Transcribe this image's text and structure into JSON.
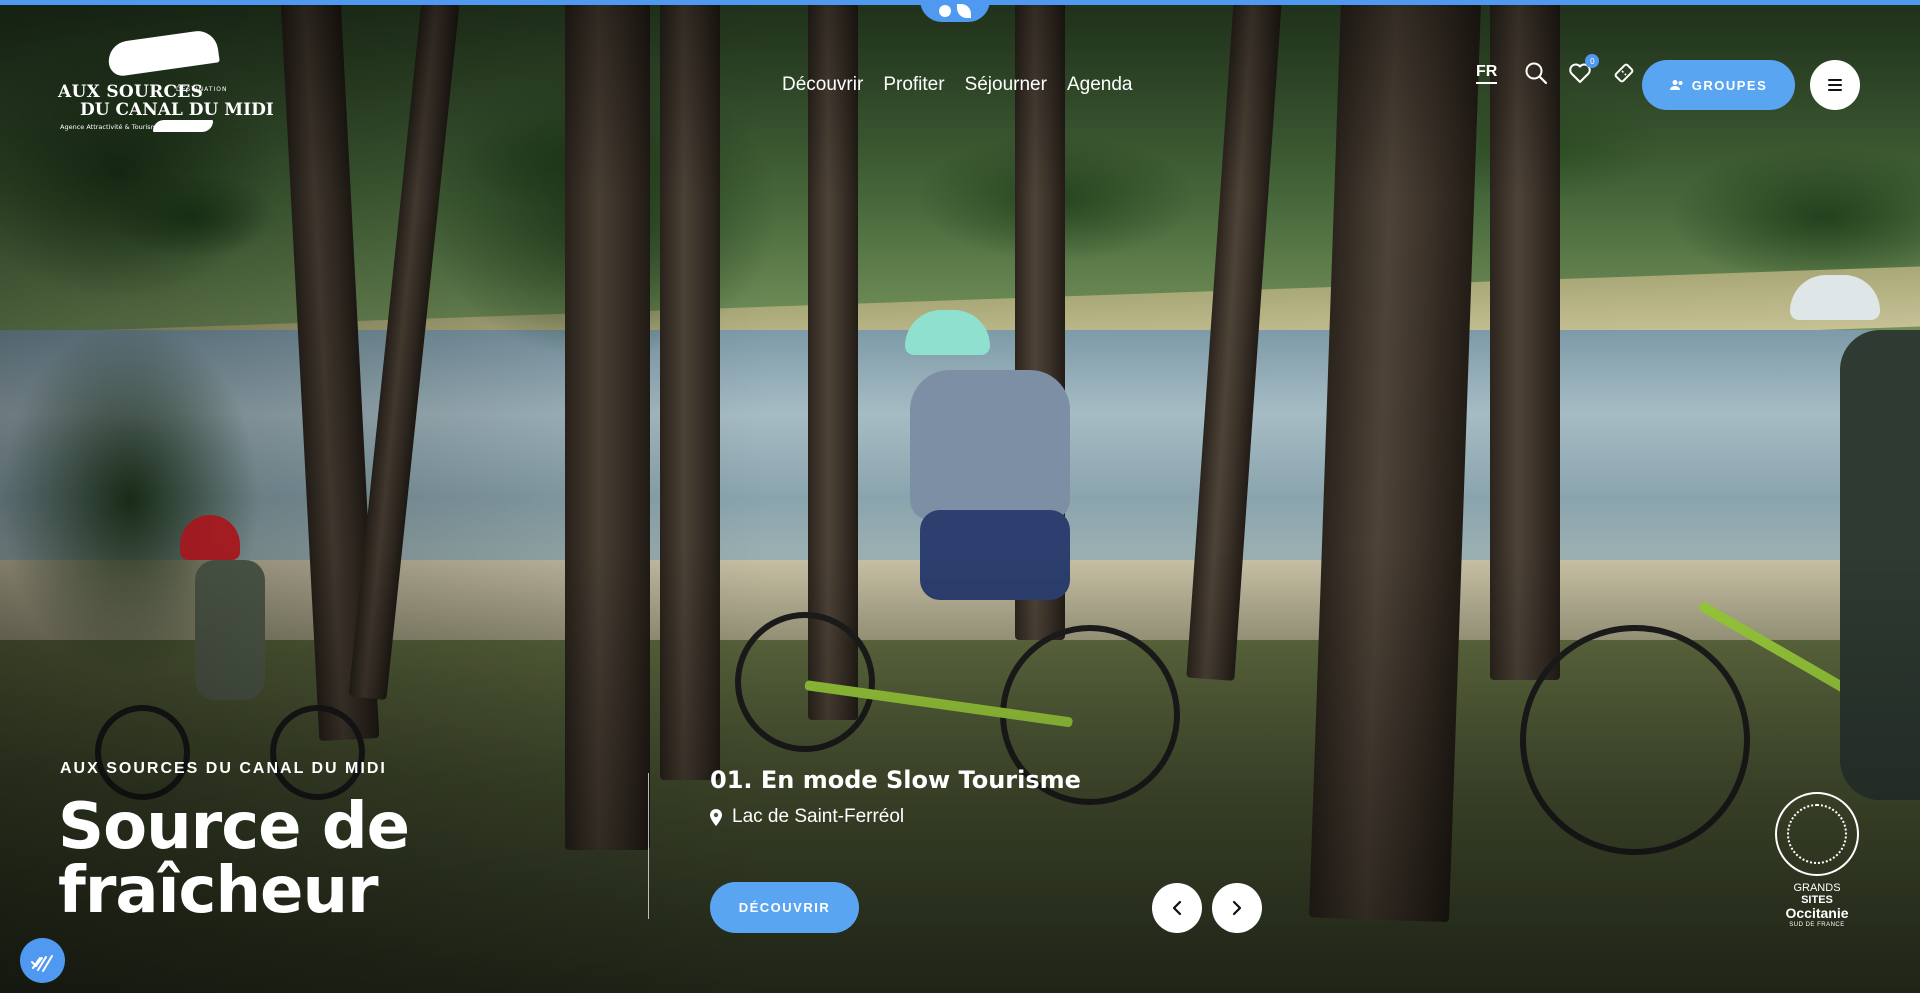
{
  "top_bar": {
    "accent": "#4f9af0"
  },
  "logo": {
    "line1": "AUX SOURCES",
    "destination": "DESTINATION",
    "line2": "DU CANAL DU MIDI",
    "tagline": "Agence Attractivité & Tourisme"
  },
  "nav": {
    "items": [
      {
        "label": "Découvrir"
      },
      {
        "label": "Profiter"
      },
      {
        "label": "Séjourner"
      },
      {
        "label": "Agenda"
      }
    ]
  },
  "utils": {
    "lang": "FR",
    "favorites_count": "0",
    "search_icon": "search-icon",
    "heart_icon": "heart-icon",
    "ticket_icon": "ticket-icon",
    "groups_label": "GROUPES",
    "menu_icon": "hamburger-icon"
  },
  "hero": {
    "kicker": "AUX SOURCES DU CANAL DU MIDI",
    "title": "Source de fraîcheur",
    "slide_title": "01. En mode Slow Tourisme",
    "slide_location": "Lac de Saint-Ferréol",
    "cta_label": "DÉCOUVRIR",
    "prev_icon": "chevron-left-icon",
    "next_icon": "chevron-right-icon"
  },
  "badge": {
    "line1": "GRANDS",
    "line2": "SITES",
    "line3": "Occitanie",
    "line4": "SUD DE FRANCE"
  },
  "colors": {
    "accent": "#5aa5f2",
    "white": "#ffffff"
  }
}
